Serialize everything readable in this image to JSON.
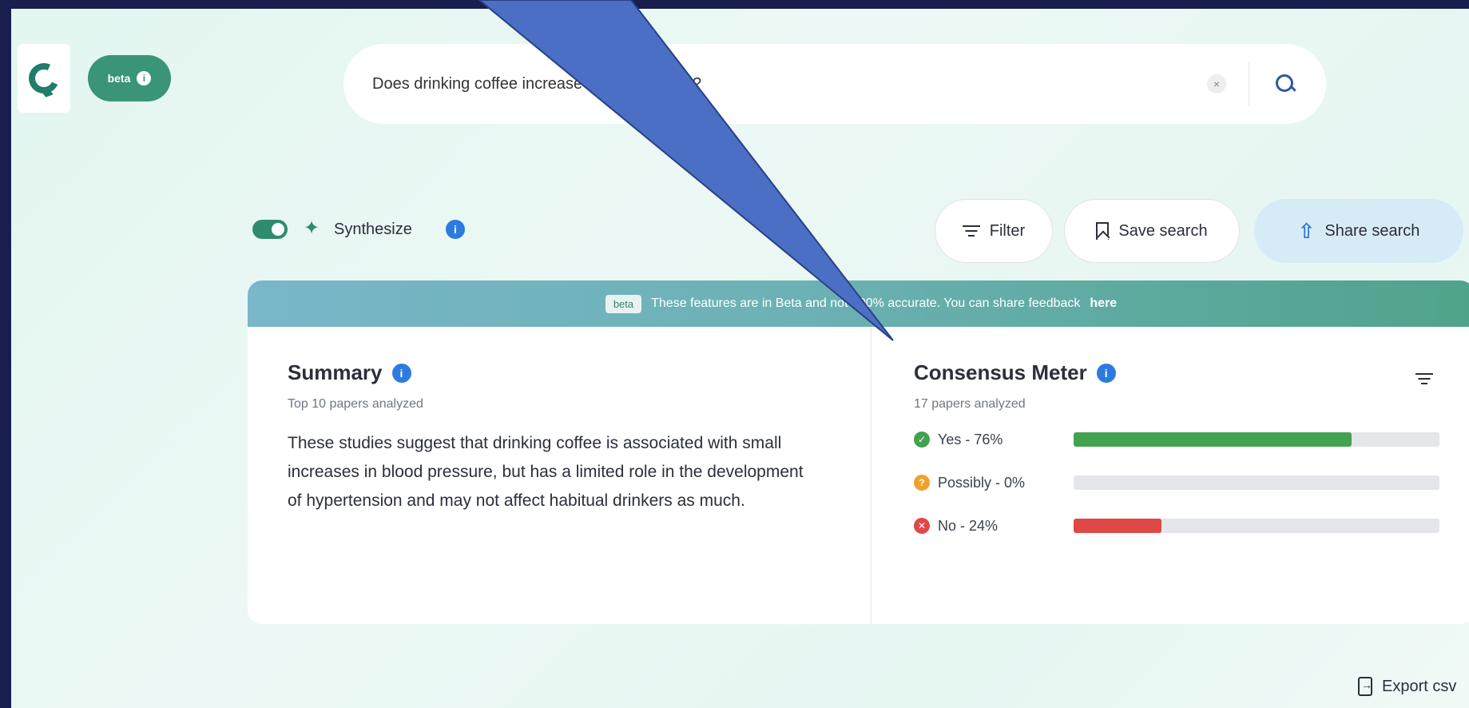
{
  "brand": {
    "beta_label": "beta"
  },
  "search": {
    "query": "Does drinking coffee increase blood pressure?",
    "clear_glyph": "×"
  },
  "controls": {
    "synthesize_label": "Synthesize",
    "filter_label": "Filter",
    "save_label": "Save search",
    "share_label": "Share search"
  },
  "banner": {
    "tag": "beta",
    "text": "These features are in Beta and not 100% accurate. You can share feedback",
    "link": "here"
  },
  "summary": {
    "title": "Summary",
    "subtitle": "Top 10 papers analyzed",
    "body": "These studies suggest that drinking coffee is associated with small increases in blood pressure, but has a limited role in the development of hypertension and may not affect habitual drinkers as much."
  },
  "consensus": {
    "title": "Consensus Meter",
    "subtitle": "17 papers analyzed",
    "rows": [
      {
        "label": "Yes - 76%",
        "percent": 76,
        "color": "#43a24f",
        "icon": "check-circle-icon",
        "glyph": "✓"
      },
      {
        "label": "Possibly - 0%",
        "percent": 0,
        "color": "#f0a12c",
        "icon": "question-circle-icon",
        "glyph": "?"
      },
      {
        "label": "No - 24%",
        "percent": 24,
        "color": "#e04848",
        "icon": "x-circle-icon",
        "glyph": "✕"
      }
    ]
  },
  "footer": {
    "export_label": "Export csv"
  },
  "colors": {
    "accent": "#2e8b6e",
    "info": "#2d7be0",
    "arrow": "#4a6fc4",
    "frame_border": "#1a1e4e"
  }
}
